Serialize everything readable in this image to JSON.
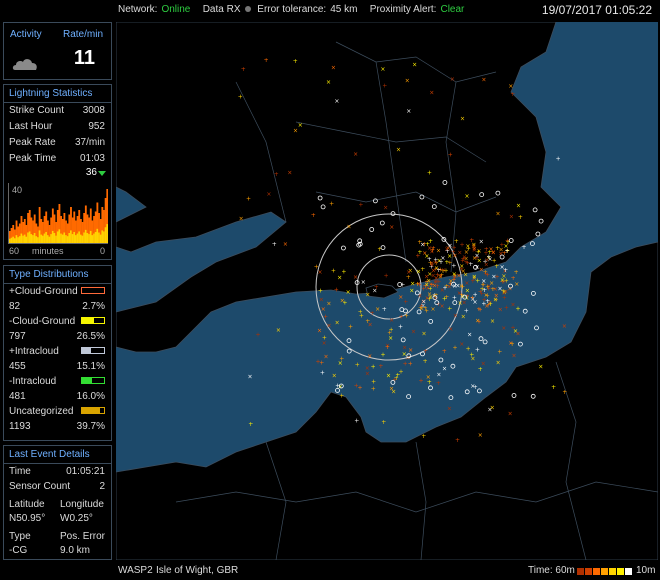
{
  "status": {
    "network_label": "Network:",
    "network_value": "Online",
    "datarx_label": "Data RX",
    "error_tol_label": "Error tolerance:",
    "error_tol_value": "45 km",
    "proximity_label": "Proximity Alert:",
    "proximity_value": "Clear",
    "datetime": "19/07/2017 01:05:22"
  },
  "activity": {
    "label": "Activity",
    "rate_label": "Rate/min",
    "rate_value": "11",
    "icon": "cloud-icon"
  },
  "stats": {
    "title": "Lightning Statistics",
    "rows": [
      {
        "label": "Strike Count",
        "value": "3008"
      },
      {
        "label": "Last Hour",
        "value": "952"
      },
      {
        "label": "Peak Rate",
        "value": "37/min"
      },
      {
        "label": "Peak Time",
        "value": "01:03"
      }
    ],
    "current_marker": "36",
    "hist_ymax": "40",
    "axis_left": "60",
    "axis_mid": "minutes",
    "axis_right": "0",
    "histogram": [
      8,
      10,
      12,
      9,
      15,
      11,
      13,
      18,
      14,
      16,
      12,
      20,
      22,
      17,
      15,
      19,
      13,
      11,
      24,
      16,
      14,
      18,
      21,
      15,
      12,
      17,
      23,
      19,
      14,
      22,
      26,
      18,
      16,
      20,
      15,
      13,
      19,
      24,
      17,
      21,
      15,
      18,
      22,
      16,
      14,
      20,
      25,
      19,
      17,
      23,
      15,
      18,
      21,
      27,
      20,
      16,
      24,
      22,
      30,
      36
    ],
    "colors": {
      "orange": "#ff6a00",
      "yellow": "#ffd400"
    }
  },
  "types": {
    "title": "Type Distributions",
    "items": [
      {
        "label": "+Cloud-Ground",
        "count": "82",
        "pct": "2.7%",
        "color": "#ff6a3a",
        "fill": 0.0
      },
      {
        "label": "-Cloud-Ground",
        "count": "797",
        "pct": "26.5%",
        "color": "#f5f500",
        "fill": 0.55
      },
      {
        "label": "+Intracloud",
        "count": "455",
        "pct": "15.1%",
        "color": "#c0c8d8",
        "fill": 0.4
      },
      {
        "label": "-Intracloud",
        "count": "481",
        "pct": "16.0%",
        "color": "#33dd33",
        "fill": 0.45
      },
      {
        "label": "Uncategorized",
        "count": "1193",
        "pct": "39.7%",
        "color": "#d9a400",
        "fill": 0.8
      }
    ]
  },
  "event": {
    "title": "Last Event Details",
    "time_label": "Time",
    "time_value": "01:05:21",
    "sensor_label": "Sensor Count",
    "sensor_value": "2",
    "lat_label": "Latitude",
    "lat_value": "N50.95°",
    "lon_label": "Longitude",
    "lon_value": "W0.25°",
    "type_label": "Type",
    "type_value": "-CG",
    "poserr_label": "Pos. Error",
    "poserr_value": "9.0 km"
  },
  "footer": {
    "station": "WASP2",
    "location": "Isle of Wight, GBR",
    "time_label": "Time:",
    "time_start": "60m",
    "time_end": "10m",
    "scale_colors": [
      "#b03000",
      "#d04000",
      "#ff6a00",
      "#ffa000",
      "#ffd400",
      "#fff000",
      "#ffffff"
    ]
  },
  "map": {
    "sea_color": "#1d4a6b",
    "land_color": "#000000",
    "border_color": "#3d4d5d"
  }
}
